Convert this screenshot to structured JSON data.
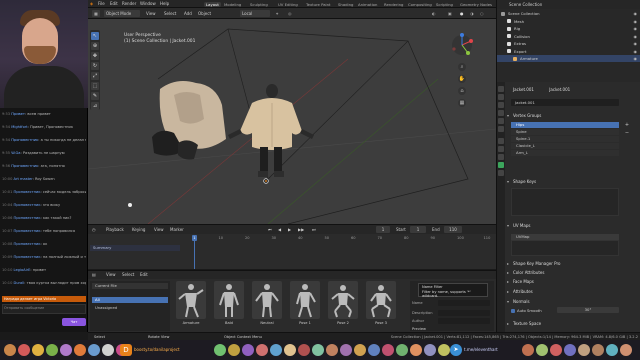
{
  "topbar": {
    "menus": [
      "File",
      "Edit",
      "Render",
      "Window",
      "Help"
    ],
    "workspaces": [
      "Layout",
      "Modeling",
      "Sculpting",
      "UV Editing",
      "Texture Paint",
      "Shading",
      "Animation",
      "Rendering",
      "Compositing",
      "Scripting",
      "Geometry Nodes"
    ],
    "active_workspace": "Layout",
    "scene": "Scene",
    "view_layer": "View Layer"
  },
  "viewport_header": {
    "mode": "Object Mode",
    "menus": [
      "View",
      "Select",
      "Add",
      "Object"
    ],
    "orientation": "Local"
  },
  "viewport": {
    "view_name": "User Perspective",
    "collection_path": "(1) Scene Collection | Jacket.001"
  },
  "timeline": {
    "playback_label": "Playback",
    "keying_label": "Keying",
    "view_label": "View",
    "marker_label": "Marker",
    "summary_label": "Summary",
    "current_frame": "1",
    "start_label": "Start",
    "start_value": "1",
    "end_label": "End",
    "end_value": "110",
    "ticks": [
      "0",
      "10",
      "20",
      "30",
      "40",
      "50",
      "60",
      "70",
      "80",
      "90",
      "100",
      "110"
    ]
  },
  "asset_browser": {
    "menus": [
      "View",
      "Select",
      "Edit"
    ],
    "library_label": "Current File",
    "libraries": [
      "All",
      "Unassigned"
    ],
    "assets": [
      "Armature",
      "Bald",
      "Neutral",
      "Pose 1",
      "Pose 2",
      "Pose 3"
    ],
    "tooltip_title": "Name Filter",
    "tooltip_text": "Filter by name, supports '*' wildcard.",
    "fields": [
      "Name",
      "Description",
      "Author"
    ],
    "preview_label": "Preview"
  },
  "outliner": {
    "header": "Scene Collection",
    "rows": [
      "Scene Collection",
      "Mesh",
      "Rig",
      "Collision",
      "Extras",
      "Export",
      "Armature"
    ]
  },
  "properties": {
    "object_name": "Jacket.001",
    "data_name": "Jacket.001",
    "mesh_name": "Jacket.001",
    "sections": {
      "vertex_groups": "Vertex Groups",
      "shape_keys": "Shape Keys",
      "uv_maps": "UV Maps",
      "shape_key_manager": "Shape Key Manager Pro",
      "color_attributes": "Color Attributes",
      "face_maps": "Face Maps",
      "attributes": "Attributes",
      "normals": "Normals",
      "texture_space": "Texture Space"
    },
    "vertex_groups": [
      "Hips",
      "Spine",
      "Spine.1",
      "Clavicle_L",
      "Arm_L"
    ],
    "uv_map": "UVMap",
    "auto_smooth_label": "Auto Smooth",
    "auto_smooth_value": "30°"
  },
  "status": {
    "left_items": [
      "Select",
      "Rotate View",
      "Object Context Menu"
    ],
    "right_text": "Scene Collection | Jacket.001 | Verts:81,112 | Faces:145,865 | Tris:274,176 | Objects:1/14 | Memory: 964.3 MiB | VRAM: 4.8/6.0 GiB | 3.2.2"
  },
  "chat": {
    "messages": [
      {
        "time": "9:53",
        "user": "Привет",
        "text": "всем привет"
      },
      {
        "time": "9:54",
        "user": "Mightfort",
        "text": "Привет, Проповестник"
      },
      {
        "time": "9:54",
        "user": "Проповестник",
        "text": "а ты никогда не делал модели для других игр?"
      },
      {
        "time": "9:55",
        "user": "W.Ga",
        "text": "Раздавить не шарную"
      },
      {
        "time": "9:56",
        "user": "Проповестник",
        "text": "ага, понятно"
      },
      {
        "time": "10:00",
        "user": "Art master",
        "text": "Roy Sowen"
      },
      {
        "time": "10:01",
        "user": "Проповестник",
        "text": "сейчас модель забросили?"
      },
      {
        "time": "10:04",
        "user": "Проповестник",
        "text": "это вижу"
      },
      {
        "time": "10:06",
        "user": "Проповестник",
        "text": "как такой ник?"
      },
      {
        "time": "10:07",
        "user": "Проповестник",
        "text": "тебе понравился"
      },
      {
        "time": "10:08",
        "user": "Проповестник",
        "text": "ок"
      },
      {
        "time": "10:09",
        "user": "Проповестник",
        "text": "на полный ложный и так кручено"
      },
      {
        "time": "10:10",
        "user": "LegioAirE",
        "text": "привет"
      },
      {
        "time": "10:10",
        "user": "Durall",
        "text": "твоя куртка выглядит прям хорошо"
      }
    ],
    "highlight": "Награда делает игра Victoria",
    "input_placeholder": "Отправить сообщение",
    "send_label": "Чат"
  },
  "promo": {
    "left": "boosty.to/danilaproject",
    "right": "t.me/eleventhart"
  }
}
